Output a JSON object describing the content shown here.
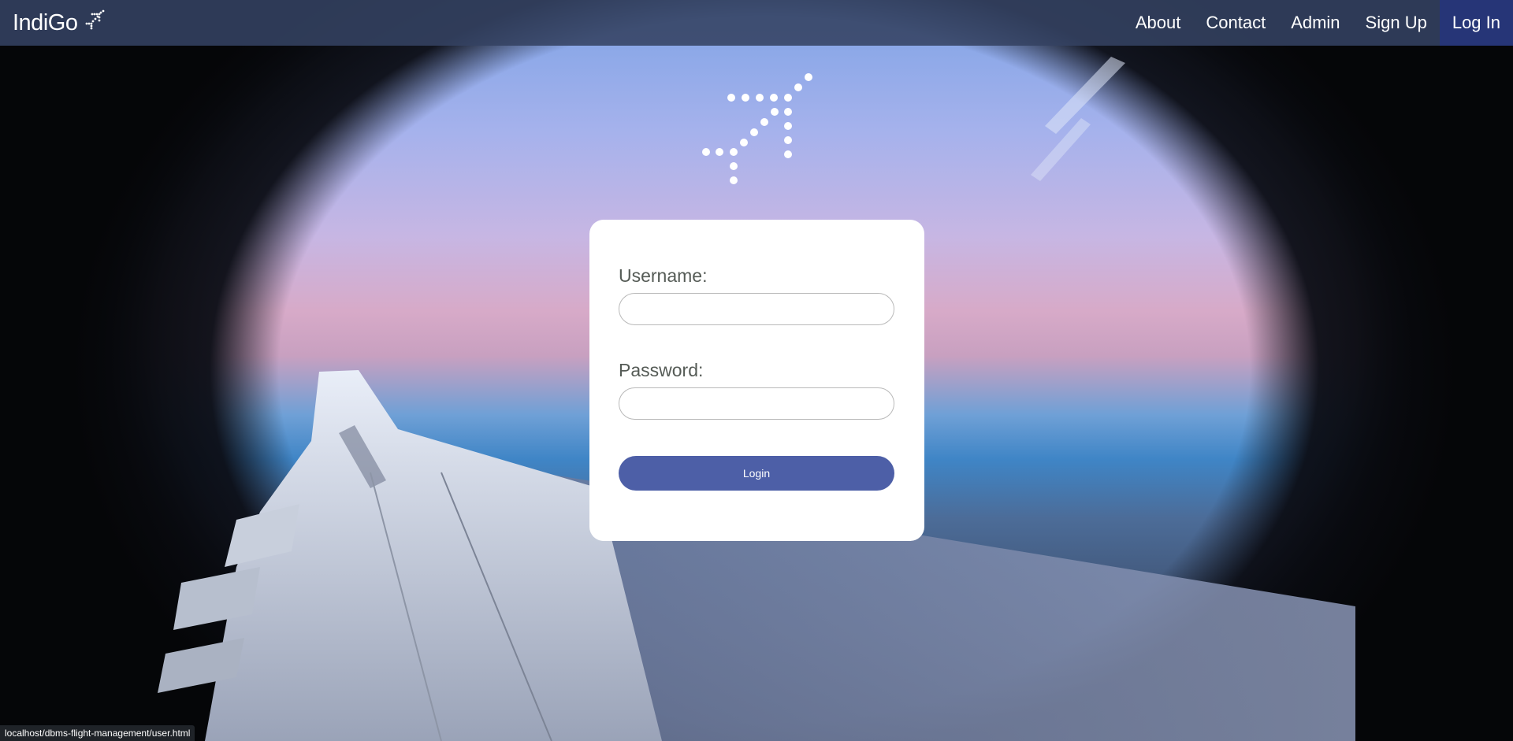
{
  "navbar": {
    "brand": "IndiGo",
    "brand_icon": "plane-dots-icon",
    "links": [
      {
        "label": "About"
      },
      {
        "label": "Contact"
      },
      {
        "label": "Admin"
      },
      {
        "label": "Sign Up"
      },
      {
        "label": "Log In",
        "active": true
      }
    ]
  },
  "hero": {
    "logo_icon": "plane-dots-icon"
  },
  "form": {
    "username_label": "Username:",
    "username_value": "",
    "password_label": "Password:",
    "password_value": "",
    "submit_label": "Login"
  },
  "status_bar": {
    "url": "localhost/dbms-flight-management/user.html"
  },
  "colors": {
    "navbar": "#344262",
    "active_link": "#263577",
    "button": "#4d5fa7",
    "card": "#ffffff"
  }
}
